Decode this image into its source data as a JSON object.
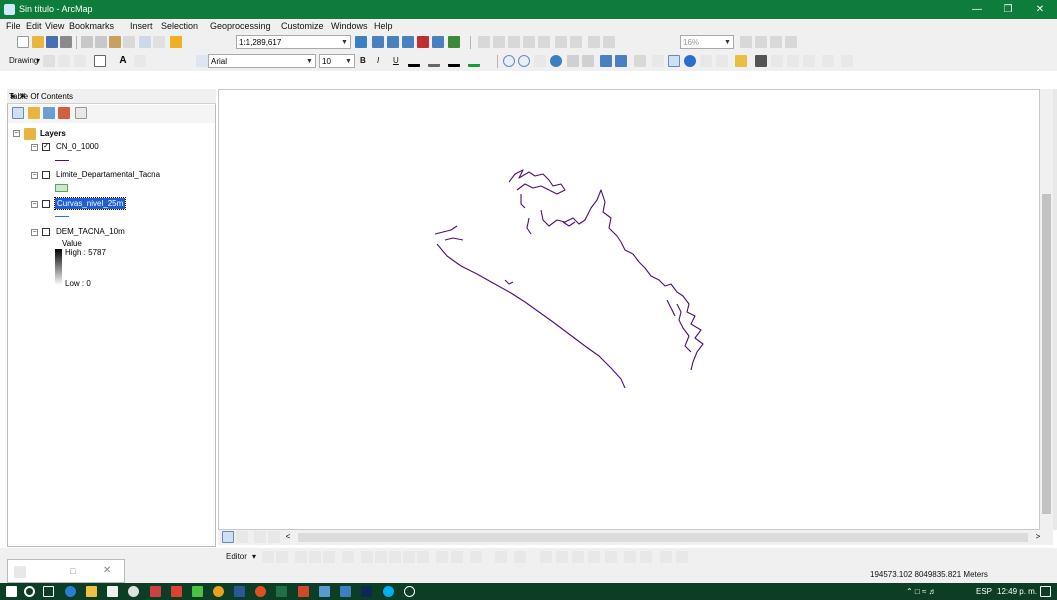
{
  "window": {
    "title": "Sin título - ArcMap"
  },
  "menu": [
    "File",
    "Edit",
    "View",
    "Bookmarks",
    "Insert",
    "Selection",
    "Geoprocessing",
    "Customize",
    "Windows",
    "Help"
  ],
  "toolbar": {
    "scale": "1:1,289,617",
    "zoom_percent": "16%",
    "drawing_label": "Drawing",
    "font": "Arial",
    "font_size": "10"
  },
  "toc": {
    "title": "Table Of Contents",
    "root": "Layers",
    "layers": [
      {
        "name": "CN_0_1000",
        "checked": true
      },
      {
        "name": "Limite_Departamental_Tacna",
        "checked": false
      },
      {
        "name": "Curvas_nivel_25m",
        "checked": false
      },
      {
        "name": "DEM_TACNA_10m",
        "checked": false
      }
    ],
    "legend": {
      "value_label": "Value",
      "high": "High : 5787",
      "low": "Low : 0"
    }
  },
  "editor": {
    "label": "Editor"
  },
  "status": {
    "coords": "194573.102  8049835.821 Meters"
  },
  "taskbar": {
    "lang": "ESP",
    "time": "12:49 p. m."
  },
  "colors": {
    "title_bar": "#0e7c3a",
    "contour": "#4b0f7a",
    "selected": "#1e5fd6"
  }
}
